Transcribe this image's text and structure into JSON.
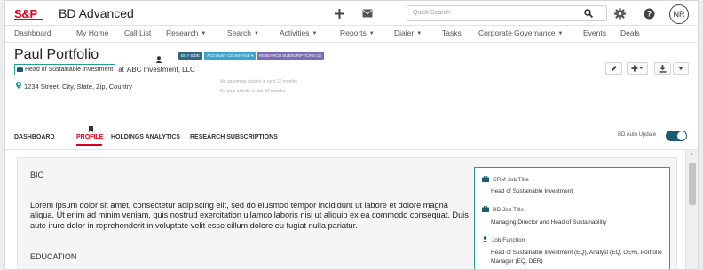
{
  "app": {
    "brand": "S&P",
    "name": "BD Advanced"
  },
  "topbar": {
    "search_placeholder": "Quick Search",
    "avatar_initials": "NR",
    "icons": [
      "plus-icon",
      "mail-icon",
      "search-icon",
      "gear-icon",
      "help-icon"
    ]
  },
  "nav": {
    "items": [
      {
        "label": "Dashboard"
      },
      {
        "label": "My Home"
      },
      {
        "label": "Call List"
      },
      {
        "label": "Research"
      },
      {
        "label": "Search"
      },
      {
        "label": "Activities"
      },
      {
        "label": "Reports"
      },
      {
        "label": "Dialer"
      },
      {
        "label": "Tasks"
      },
      {
        "label": "Corporate Governance"
      },
      {
        "label": "Events"
      },
      {
        "label": "Deals"
      }
    ]
  },
  "person": {
    "name": "Paul Portfolio",
    "tags": [
      {
        "label": "BUY SIDE",
        "color": "#2d6a8a"
      },
      {
        "label": "ACCOUNT COVERAGE ▾",
        "color": "#3aa6d0"
      },
      {
        "label": "RESEARCH SUBSCRIPTIONS (1)",
        "color": "#7b6bb8"
      }
    ],
    "job_title": "Head of Sustainable Investment",
    "job_at": "at",
    "company": "ABC Investment, LLC",
    "address": "1234 Street, City, State, Zip, Country",
    "upcoming_activity": "No upcoming activity in next 12 months",
    "past_activity": "No past activity in last 12 months"
  },
  "tabs": [
    {
      "label": "DASHBOARD",
      "active": false
    },
    {
      "label": "PROFILE",
      "active": true
    },
    {
      "label": "HOLDINGS ANALYTICS",
      "active": false
    },
    {
      "label": "RESEARCH SUBSCRIPTIONS",
      "active": false
    }
  ],
  "bd_auto_update": {
    "label": "BD Auto Update",
    "on": true
  },
  "bio": {
    "heading": "BIO",
    "text": "Lorem ipsum dolor sit amet, consectetur adipiscing elit, sed do eiusmod tempor incididunt ut labore et dolore magna aliqua. Ut enim ad minim veniam, quis nostrud exercitation ullamco laboris nisi ut aliquip ex ea commodo consequat. Duis aute irure dolor in reprehenderit in voluptate velit esse cillum dolore eu fugiat nulla pariatur.",
    "education_heading": "EDUCATION"
  },
  "sidebox": {
    "crm_label": "CRM Job Title",
    "crm_value": "Head of Sustainable Investment",
    "bd_label": "BD Job Title",
    "bd_value": "Managing Director and Head of Sustainability",
    "func_label": "Job Function",
    "func_value": "Head of Sustainable Investment (EQ), Analyst (EQ, DER), Portfolio Manager (EQ, DER)"
  },
  "colors": {
    "brand_red": "#d6001c",
    "accent_teal": "#20a08d",
    "toggle": "#1d5b6e"
  }
}
